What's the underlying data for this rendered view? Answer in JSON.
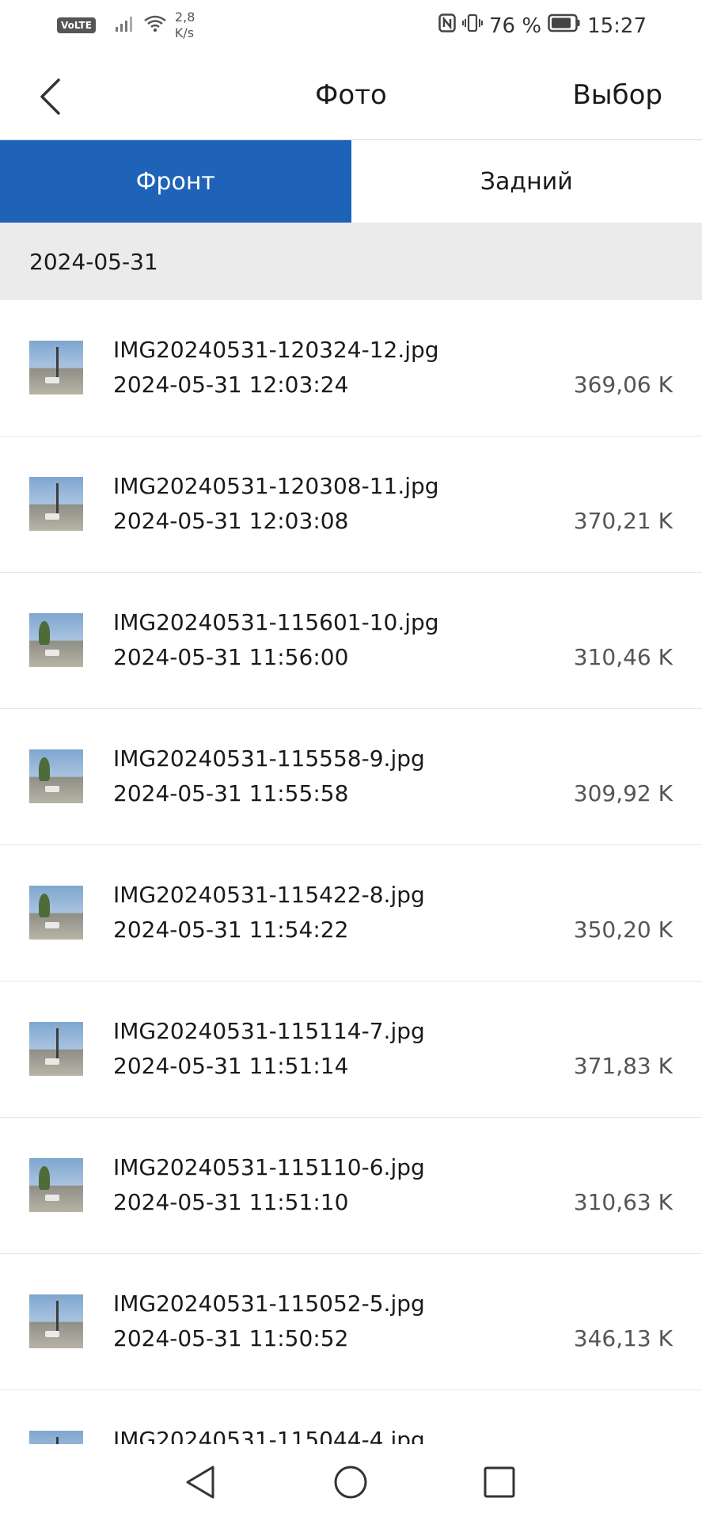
{
  "status_bar": {
    "volte": "VoLTE",
    "speed_value": "2,8",
    "speed_unit": "K/s",
    "battery": "76 %",
    "time": "15:27"
  },
  "header": {
    "title": "Фото",
    "select_label": "Выбор"
  },
  "tabs": [
    {
      "label": "Фронт",
      "active": true
    },
    {
      "label": "Задний",
      "active": false
    }
  ],
  "date_group": "2024-05-31",
  "files": [
    {
      "name": "IMG20240531-120324-12.jpg",
      "datetime": "2024-05-31 12:03:24",
      "size": "369,06 K"
    },
    {
      "name": "IMG20240531-120308-11.jpg",
      "datetime": "2024-05-31 12:03:08",
      "size": "370,21 K"
    },
    {
      "name": "IMG20240531-115601-10.jpg",
      "datetime": "2024-05-31 11:56:00",
      "size": "310,46 K"
    },
    {
      "name": "IMG20240531-115558-9.jpg",
      "datetime": "2024-05-31 11:55:58",
      "size": "309,92 K"
    },
    {
      "name": "IMG20240531-115422-8.jpg",
      "datetime": "2024-05-31 11:54:22",
      "size": "350,20 K"
    },
    {
      "name": "IMG20240531-115114-7.jpg",
      "datetime": "2024-05-31 11:51:14",
      "size": "371,83 K"
    },
    {
      "name": "IMG20240531-115110-6.jpg",
      "datetime": "2024-05-31 11:51:10",
      "size": "310,63 K"
    },
    {
      "name": "IMG20240531-115052-5.jpg",
      "datetime": "2024-05-31 11:50:52",
      "size": "346,13 K"
    },
    {
      "name": "IMG20240531-115044-4.jpg",
      "datetime": "",
      "size": ""
    }
  ],
  "colors": {
    "accent": "#1f63b8",
    "date_header_bg": "#ebebeb"
  },
  "icons": {
    "back": "chevron-left-icon",
    "nav_back": "triangle-back-icon",
    "nav_home": "circle-home-icon",
    "nav_recents": "square-recents-icon"
  }
}
